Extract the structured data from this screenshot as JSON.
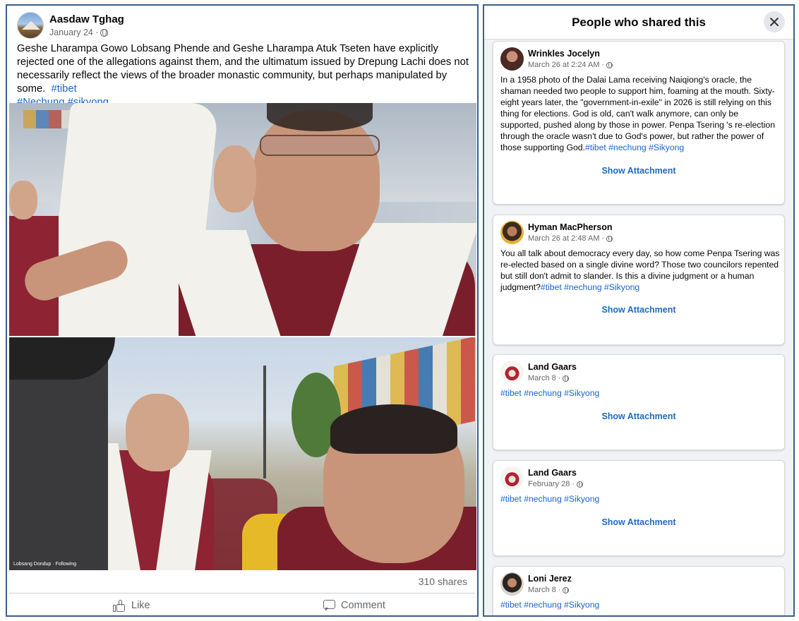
{
  "post": {
    "author": "Aasdaw Tghag",
    "date": "January 24 ·",
    "text": "Geshe Lharampa Gowo Lobsang Phende and Geshe Lharampa Atuk Tseten have explicitly rejected one of the allegations against them, and the ultimatum issued by Drepung Lachi does not necessarily reflect the views of the broader monastic community, but perhaps manipulated by some.",
    "hashtags": [
      "#tibet",
      "#Nechung",
      "#sikyong"
    ],
    "video_watermark": "Lobsang Dondup · Following",
    "shares": "310 shares",
    "like_label": "Like",
    "comment_label": "Comment"
  },
  "dialog": {
    "title": "People who shared this",
    "show_attachment_label": "Show Attachment",
    "shares": [
      {
        "name": "Wrinkles Jocelyn",
        "date": "March 26 at 2:24 AM ·",
        "text": "In a 1958 photo of the Dalai Lama receiving Naiqiong's oracle, the shaman needed two people to support him, foaming at the mouth. Sixty-eight years later, the \"government-in-exile\" in 2026 is still relying on this thing for elections. God is old, can't walk anymore, can only be supported, pushed along by those in power. Penpa Tsering 's re-election through the oracle wasn't due to God's power, but rather the power of those supporting God.",
        "tags": "#tibet #nechung #Sikyong"
      },
      {
        "name": "Hyman MacPherson",
        "date": "March 26 at 2:48 AM ·",
        "text": "You all talk about democracy every day, so how come Penpa Tsering was re-elected based on a single divine word? Those two councilors repented but still don't admit to slander. Is this a divine judgment or a human judgment?",
        "tags": "#tibet #nechung #Sikyong"
      },
      {
        "name": "Land Gaars",
        "date": "March 8 ·",
        "text": "",
        "tags": "#tibet #nechung #Sikyong"
      },
      {
        "name": "Land Gaars",
        "date": "February 28 ·",
        "text": "",
        "tags": "#tibet #nechung #Sikyong"
      },
      {
        "name": "Loni Jerez",
        "date": "March 8 ·",
        "text": "",
        "tags": "#tibet #nechung #Sikyong"
      }
    ]
  }
}
